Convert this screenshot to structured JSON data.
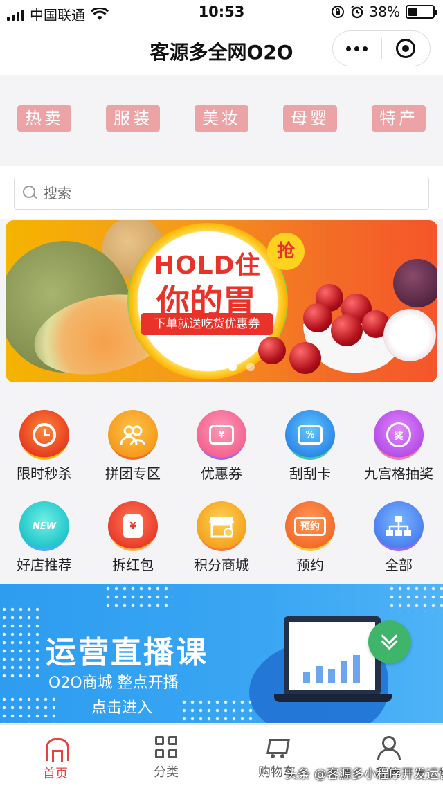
{
  "status_bar": {
    "carrier": "中国联通",
    "time": "10:53",
    "battery_percent": "38%",
    "battery_level": 0.38,
    "icons": [
      "signal-icon",
      "wifi-icon",
      "rotation-lock-icon",
      "alarm-icon",
      "battery-icon"
    ]
  },
  "nav": {
    "title": "客源多全网O2O",
    "more_icon": "more-dots-icon",
    "target_icon": "close-target-icon"
  },
  "categories": [
    {
      "label": "热卖"
    },
    {
      "label": "服装"
    },
    {
      "label": "美妆"
    },
    {
      "label": "母婴"
    },
    {
      "label": "特产"
    }
  ],
  "search": {
    "placeholder": "搜索",
    "icon": "search-icon"
  },
  "banner": {
    "headline": "HOLD住",
    "subline": "你的胃",
    "badge": "抢",
    "ribbon": "下单就送吃货优惠券",
    "page_count": 4,
    "active_page": 3
  },
  "features": [
    {
      "label": "限时秒杀",
      "icon": "alarm-clock-icon",
      "glyph": ""
    },
    {
      "label": "拼团专区",
      "icon": "group-icon",
      "glyph": ""
    },
    {
      "label": "优惠券",
      "icon": "coupon-icon",
      "glyph": "¥"
    },
    {
      "label": "刮刮卡",
      "icon": "scratch-card-icon",
      "glyph": "%"
    },
    {
      "label": "九宫格抽奖",
      "icon": "lottery-icon",
      "glyph": "奖"
    },
    {
      "label": "好店推荐",
      "icon": "new-shop-icon",
      "glyph": "NEW"
    },
    {
      "label": "拆红包",
      "icon": "red-envelope-icon",
      "glyph": "¥"
    },
    {
      "label": "积分商城",
      "icon": "points-mall-icon",
      "glyph": ""
    },
    {
      "label": "预约",
      "icon": "reservation-icon",
      "glyph": "预约"
    },
    {
      "label": "全部",
      "icon": "all-categories-icon",
      "glyph": ""
    }
  ],
  "course_banner": {
    "title": "运营直播课",
    "line1": "O2O商城  整点开播",
    "line2": "点击进入"
  },
  "fab": {
    "icon": "double-chevron-down-icon"
  },
  "tabs": [
    {
      "label": "首页",
      "icon": "home-icon",
      "active": true
    },
    {
      "label": "分类",
      "icon": "category-grid-icon",
      "active": false
    },
    {
      "label": "购物车",
      "icon": "cart-icon",
      "active": false
    },
    {
      "label": "我的",
      "icon": "user-icon",
      "active": false
    }
  ],
  "watermark": "头条 @客源多小程序开发运营",
  "colors": {
    "tag_bg": "#eba3a6",
    "active_tab": "#e64340",
    "course_blue": "#2e9df0",
    "fab_green": "#3fb56b"
  }
}
